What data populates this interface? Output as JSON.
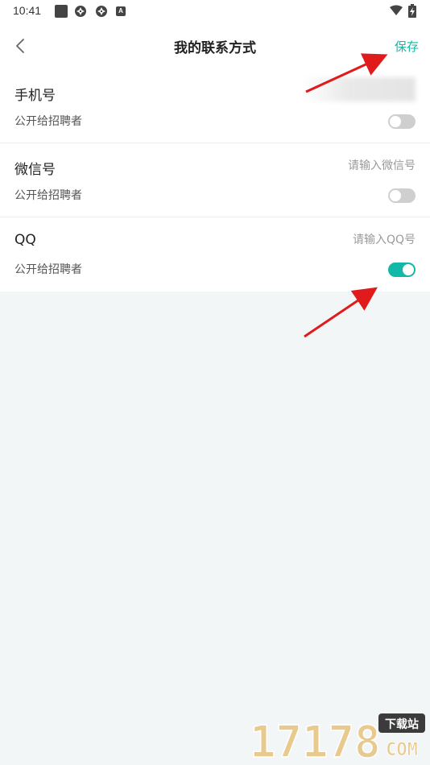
{
  "status_bar": {
    "time": "10:41"
  },
  "header": {
    "title": "我的联系方式",
    "save_label": "保存"
  },
  "rows": [
    {
      "label": "手机号",
      "sub_label": "公开给招聘者",
      "value_placeholder": "",
      "public": false
    },
    {
      "label": "微信号",
      "sub_label": "公开给招聘者",
      "value_placeholder": "请输入微信号",
      "public": false
    },
    {
      "label": "QQ",
      "sub_label": "公开给招聘者",
      "value_placeholder": "请输入QQ号",
      "public": true
    }
  ],
  "watermark": {
    "number": "17178",
    "badge": "下载站",
    "domain": "COM"
  },
  "colors": {
    "accent": "#14b8a6",
    "toggle_off": "#cfcfcf",
    "annotation_arrow": "#e01b1b",
    "watermark_gold": "#e8c98e"
  }
}
